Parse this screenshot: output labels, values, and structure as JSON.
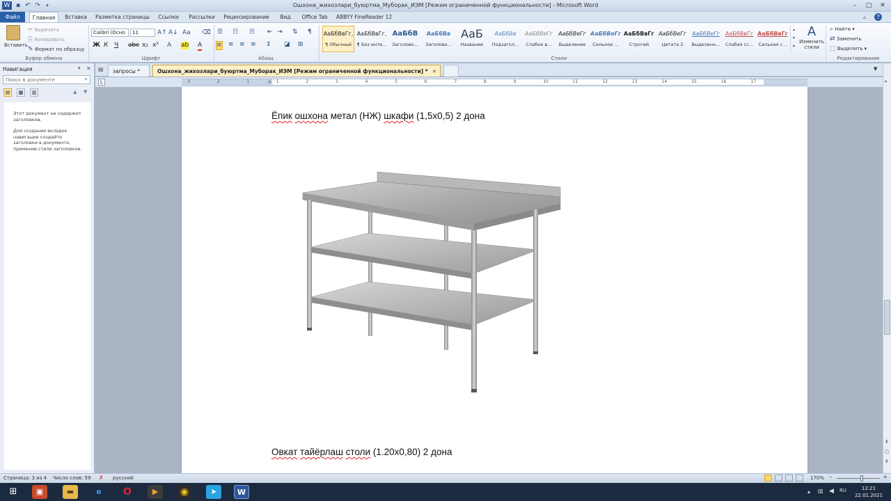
{
  "window": {
    "title": "Ошхона_жихозлари_буюртма_Муборак_ИЭМ [Режим ограниченной функциональности]  -  Microsoft Word",
    "qat_icons": [
      "word-icon",
      "save-icon",
      "undo-icon",
      "redo-icon"
    ],
    "controls": [
      "minimize-icon",
      "maximize-icon",
      "close-icon"
    ]
  },
  "ribbon": {
    "tabs": [
      "Файл",
      "Главная",
      "Вставка",
      "Разметка страницы",
      "Ссылки",
      "Рассылки",
      "Рецензирование",
      "Вид",
      "Office Tab",
      "ABBYY FineReader 12"
    ],
    "clipboard": {
      "paste": "Вставить",
      "cut": "Вырезать",
      "copy": "Копировать",
      "format_painter": "Формат по образцу",
      "label": "Буфер обмена"
    },
    "font": {
      "name": "Calibri (Осно",
      "size": "11",
      "label": "Шрифт"
    },
    "paragraph": {
      "label": "Абзац"
    },
    "styles": {
      "label": "Стили",
      "items": [
        {
          "preview": "АаБбВвГг,",
          "name": "¶ Обычный"
        },
        {
          "preview": "АаБбВвГг,",
          "name": "¶ Без инте..."
        },
        {
          "preview": "АаБбВ",
          "name": "Заголово..."
        },
        {
          "preview": "АаБбВв",
          "name": "Заголово..."
        },
        {
          "preview": "АаБ",
          "name": "Название"
        },
        {
          "preview": "АаБбВв",
          "name": "Подзагол..."
        },
        {
          "preview": "АаБбВеГг",
          "name": "Слабое в..."
        },
        {
          "preview": "АаБбВеГг",
          "name": "Выделение"
        },
        {
          "preview": "АаБбВеГг",
          "name": "Сильное ..."
        },
        {
          "preview": "АаБбВвГг,",
          "name": "Строгий"
        },
        {
          "preview": "АаБбВеГг",
          "name": "Цитата 2"
        },
        {
          "preview": "АаБбВеГг",
          "name": "Выделенн..."
        },
        {
          "preview": "АаБбВвГг",
          "name": "Слабая сс..."
        },
        {
          "preview": "АаБбВвГг",
          "name": "Сильная с..."
        }
      ],
      "change": "Изменить стили"
    },
    "editing": {
      "find": "Найти",
      "replace": "Заменить",
      "select": "Выделить",
      "label": "Редактирование"
    }
  },
  "nav": {
    "title": "Навигация",
    "search_placeholder": "Поиск в документе",
    "msg1": "Этот документ не содержит заголовков.",
    "msg2": "Для создания вкладок навигации создайте заголовки в документе, применив стили заголовков."
  },
  "doctabs": [
    "запросы *",
    "Ошхона_жихозлари_буюртма_Муборак_ИЭМ [Режим ограниченной функциональности] *"
  ],
  "document": {
    "line1": {
      "pre": "",
      "w1": "Ёпик",
      "s1": " ",
      "w2": "ошхона",
      "s2": " метал (НЖ) ",
      "w3": "шкафи",
      "post": " (1,5х0,5) 2 дона"
    },
    "line2": {
      "w1": "Овкат",
      "s1": " ",
      "w2": "тайёрлаш",
      "s2": " ",
      "w3": "столи",
      "post": " (1.20х0,80) 2 дона"
    }
  },
  "ruler_numbers": [
    "3",
    "2",
    "1",
    "1",
    "2",
    "3",
    "4",
    "5",
    "6",
    "7",
    "8",
    "9",
    "10",
    "11",
    "12",
    "13",
    "14",
    "15",
    "16",
    "17"
  ],
  "status": {
    "page": "Страница: 3 из 4",
    "words": "Число слов: 59",
    "lang": "русский",
    "zoom": "170%"
  },
  "taskbar": {
    "time": "12:21",
    "date": "22.01.2021"
  }
}
